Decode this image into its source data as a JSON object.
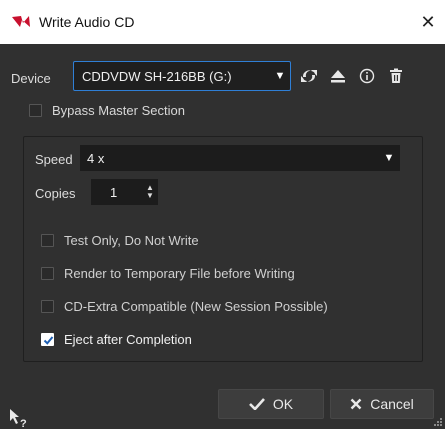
{
  "window": {
    "title": "Write Audio CD",
    "close_glyph": "✕"
  },
  "device": {
    "label": "Device",
    "selected": "CDDVDW SH-216BB (G:)",
    "icons": [
      "refresh-icon",
      "eject-icon",
      "info-icon",
      "trash-icon"
    ]
  },
  "bypass": {
    "label": "Bypass Master Section",
    "checked": false
  },
  "speed": {
    "label": "Speed",
    "selected": "4 x"
  },
  "copies": {
    "label": "Copies",
    "value": "1"
  },
  "options": [
    {
      "label": "Test Only, Do Not Write",
      "checked": false
    },
    {
      "label": "Render to Temporary File before Writing",
      "checked": false
    },
    {
      "label": "CD-Extra Compatible (New Session Possible)",
      "checked": false
    },
    {
      "label": "Eject after Completion",
      "checked": true
    }
  ],
  "buttons": {
    "ok": "OK",
    "cancel": "Cancel"
  },
  "colors": {
    "accent": "#2f7fd6",
    "brand": "#c8102e",
    "background": "#303030"
  }
}
